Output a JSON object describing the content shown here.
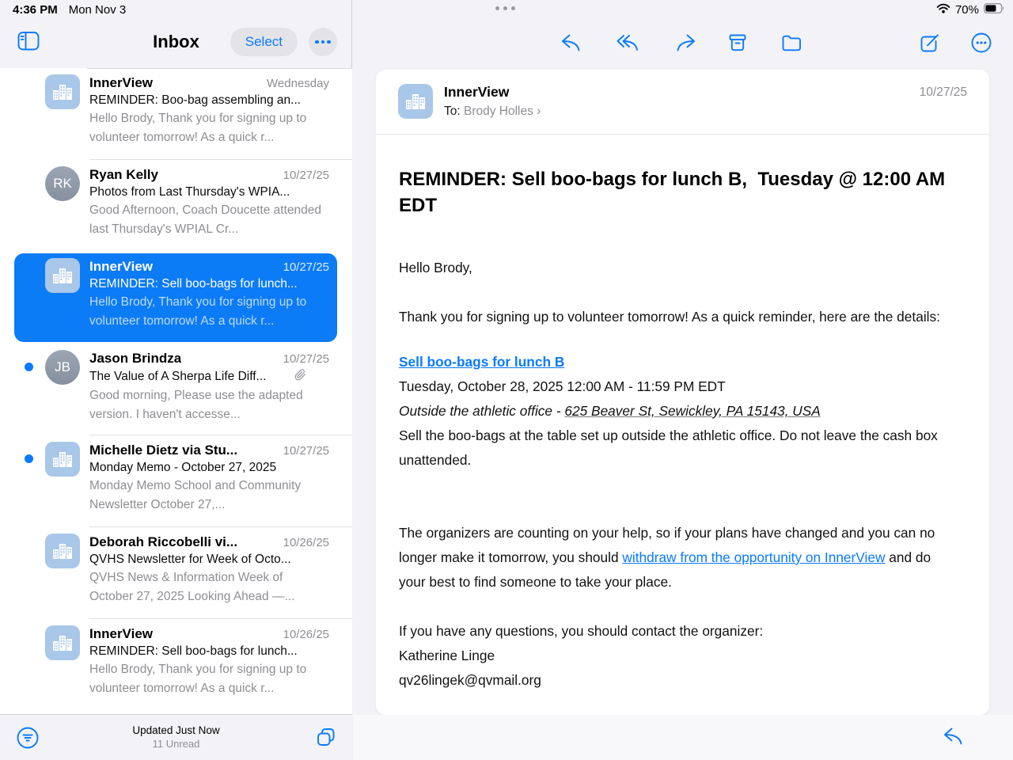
{
  "colors": {
    "accent": "#0a7aff",
    "selected_row": "#0c7bf6",
    "avatar_blue": "#a9c7e9",
    "unread_dot": "#0a7aff"
  },
  "status_bar": {
    "time": "4:36 PM",
    "date": "Mon Nov 3",
    "battery_percent": "70%"
  },
  "icons": {
    "sidebar_toggle": "split-view",
    "select_more": "ellipsis",
    "filter": "circle-lines",
    "toolbar": [
      "reply",
      "reply-all",
      "forward",
      "archive",
      "folder",
      "compose",
      "ellipsis-circle"
    ],
    "bottom_right": "reply"
  },
  "sidebar": {
    "title": "Inbox",
    "select_label": "Select",
    "footer": {
      "updated": "Updated Just Now",
      "unread": "11 Unread"
    },
    "emails": [
      {
        "sender": "InnerView",
        "date": "Wednesday",
        "subject": "REMINDER: Boo-bag assembling an...",
        "preview": "Hello Brody, Thank you for signing up to volunteer tomorrow! As a quick r..."
      },
      {
        "sender": "Ryan Kelly",
        "monogram": "RK",
        "date": "10/27/25",
        "subject": "Photos from Last Thursday's WPIA...",
        "preview": "Good Afternoon, Coach Doucette attended last Thursday's WPIAL Cr..."
      },
      {
        "sender": "InnerView",
        "date": "10/27/25",
        "subject": "REMINDER: Sell boo-bags for lunch...",
        "preview": "Hello Brody, Thank you for signing up to volunteer tomorrow! As a quick r..."
      },
      {
        "sender": "Jason Brindza",
        "monogram": "JB",
        "date": "10/27/25",
        "subject": "The Value of A Sherpa Life Diff...",
        "preview": "Good morning, Please use the adapted version. I haven't accesse..."
      },
      {
        "sender": "Michelle Dietz via Stu...",
        "date": "10/27/25",
        "subject": "Monday Memo - October 27, 2025",
        "preview": "Monday Memo School and Community Newsletter October 27,..."
      },
      {
        "sender": "Deborah Riccobelli vi...",
        "date": "10/26/25",
        "subject": "QVHS Newsletter for Week of Octo...",
        "preview": "QVHS News & Information Week of October 27, 2025 Looking Ahead —..."
      },
      {
        "sender": "InnerView",
        "date": "10/26/25",
        "subject": "REMINDER: Sell boo-bags for lunch...",
        "preview": "Hello Brody, Thank you for signing up to volunteer tomorrow! As a quick r..."
      }
    ]
  },
  "reader": {
    "sender": "InnerView",
    "to_label": "To:",
    "recipient": "Brody Holles",
    "chevron": "›",
    "date": "10/27/25",
    "subject": "REMINDER: Sell boo-bags for lunch B,  Tuesday @ 12:00 AM EDT",
    "body": {
      "greeting": "Hello Brody,",
      "intro": "Thank you for signing up to volunteer tomorrow! As a quick reminder, here are the details:",
      "event_link": "Sell boo-bags for lunch B",
      "event_time": "Tuesday, October 28, 2025 12:00 AM - 11:59 PM EDT",
      "event_location_prefix": "Outside the athletic office - ",
      "event_address": "625 Beaver St, Sewickley, PA 15143, USA",
      "event_description": "Sell the boo-bags at the table set up outside the athletic office. Do not leave the cash box unattended.",
      "help_before": "The organizers are counting on your help, so if your plans have changed and you can no longer make it tomorrow, you should ",
      "help_link": "withdraw from the opportunity on InnerView",
      "help_after": " and do your best to find someone to take your place.",
      "contact_intro": "If you have any questions, you should contact the organizer:",
      "contact_name": "Katherine Linge",
      "contact_email": "qv26lingek@qvmail.org"
    }
  }
}
